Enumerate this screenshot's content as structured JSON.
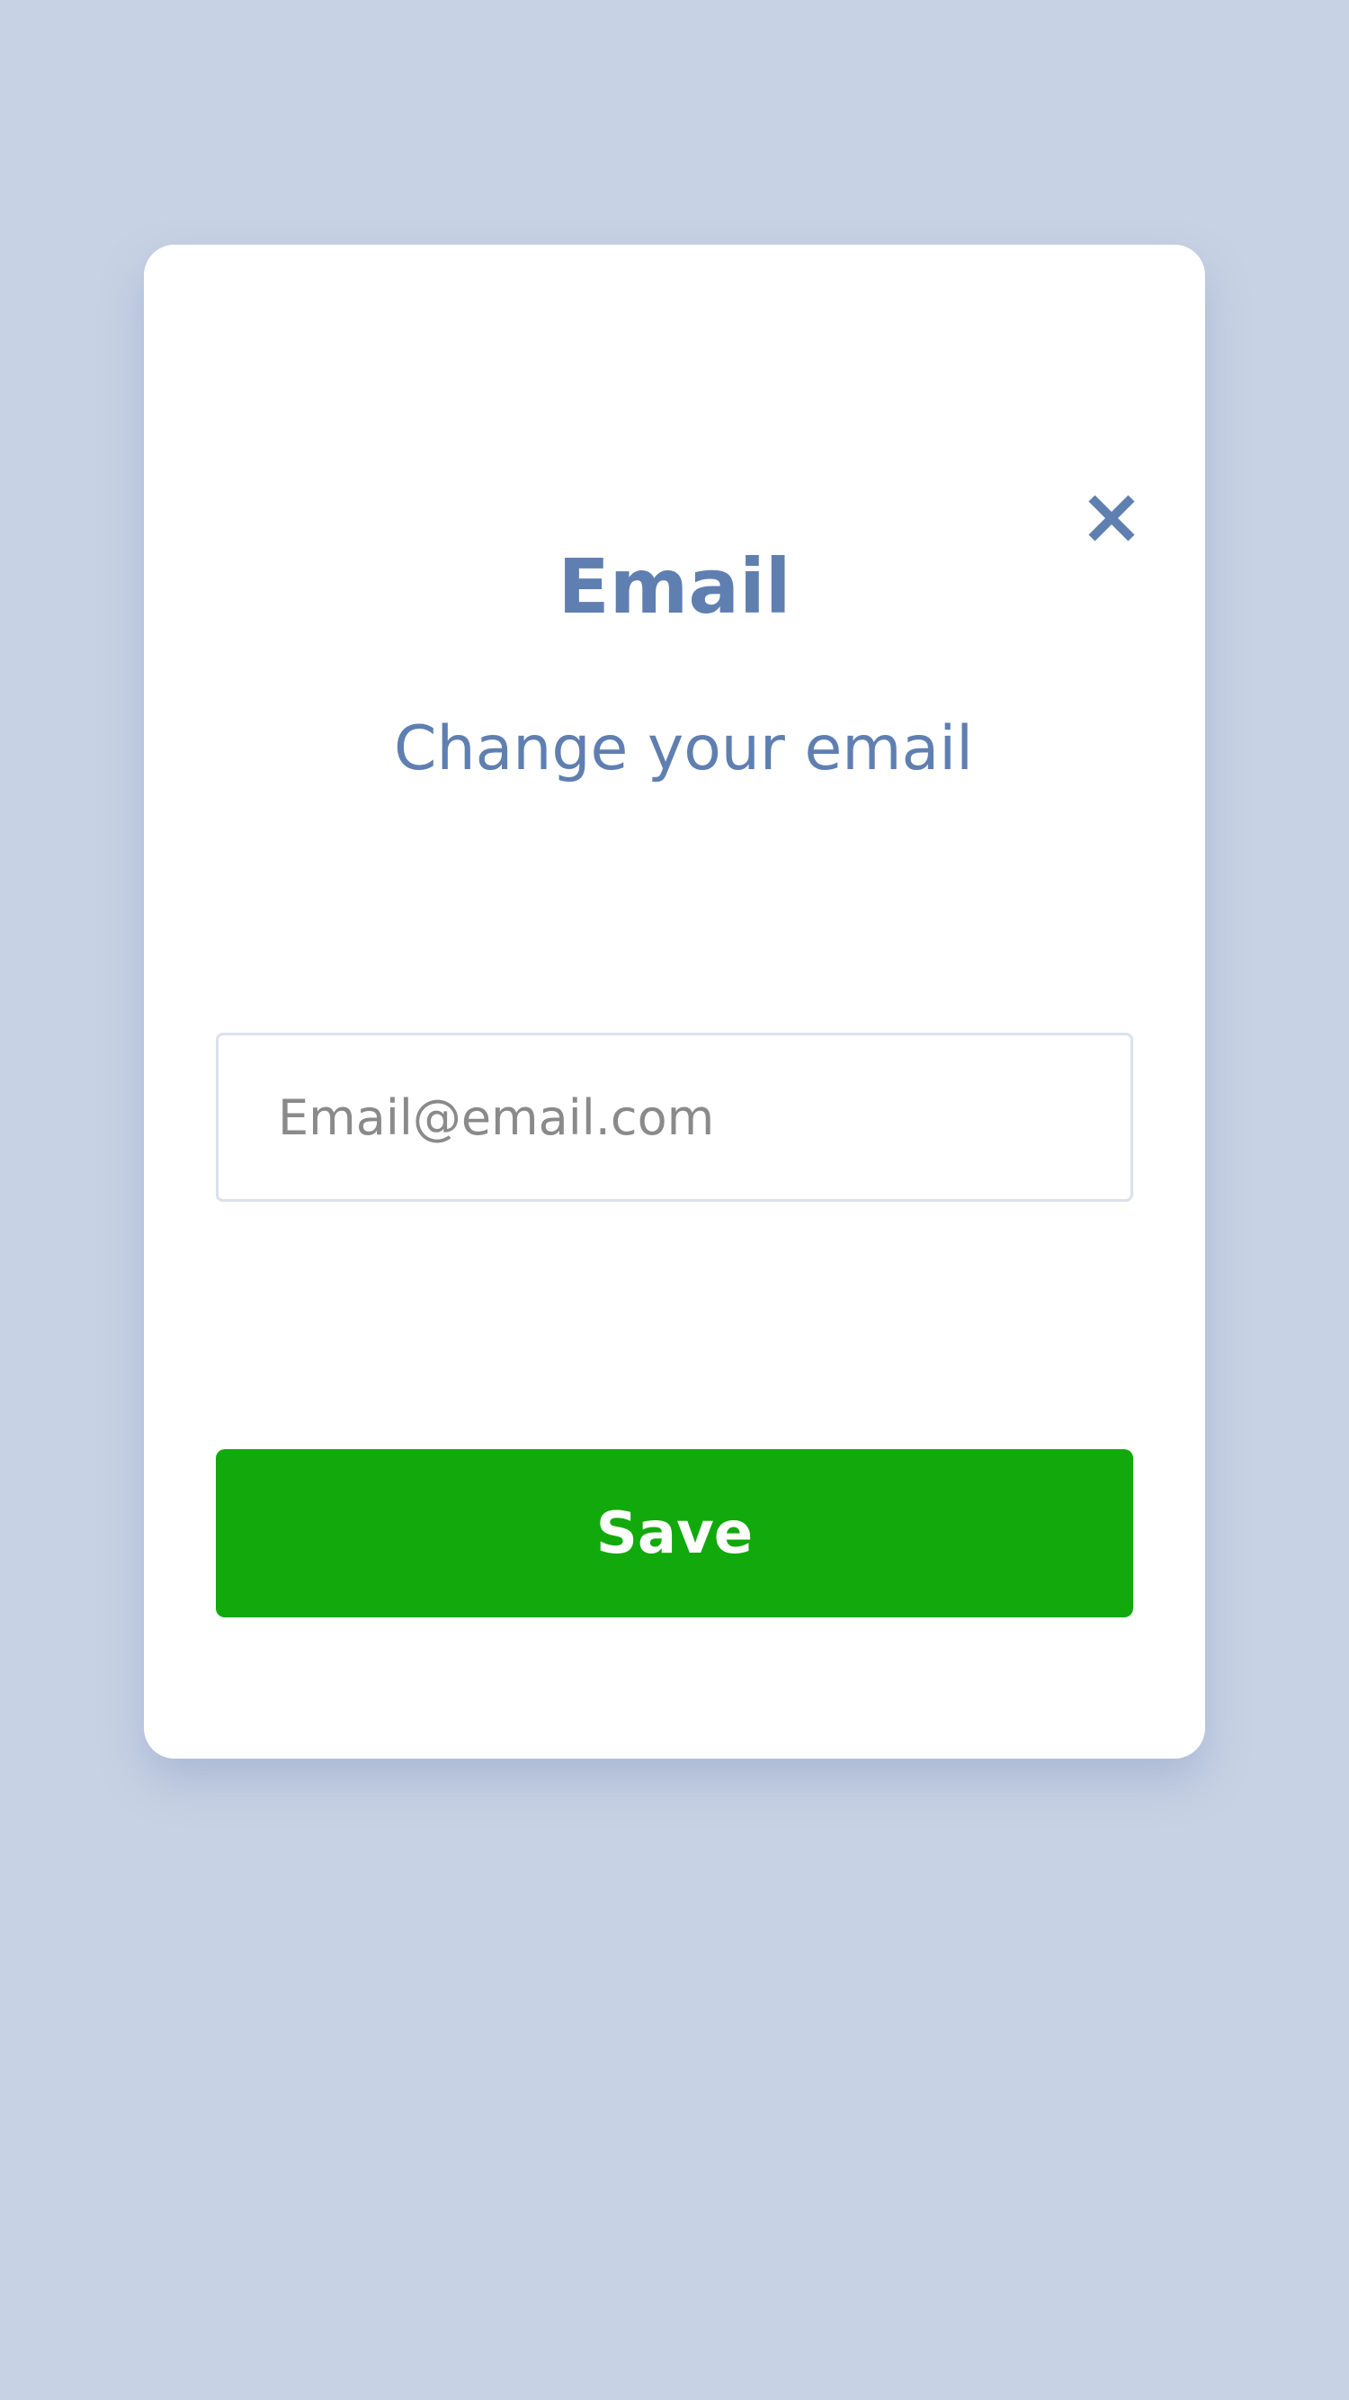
{
  "modal": {
    "title": "Email",
    "subtitle": "Change your email",
    "close_icon": "close-icon",
    "email_input": {
      "value": "",
      "placeholder": "Email@email.com"
    },
    "save_label": "Save"
  },
  "colors": {
    "background": "#c7d2e4",
    "accent_text": "#5f7fb1",
    "save_button": "#12a90d"
  }
}
